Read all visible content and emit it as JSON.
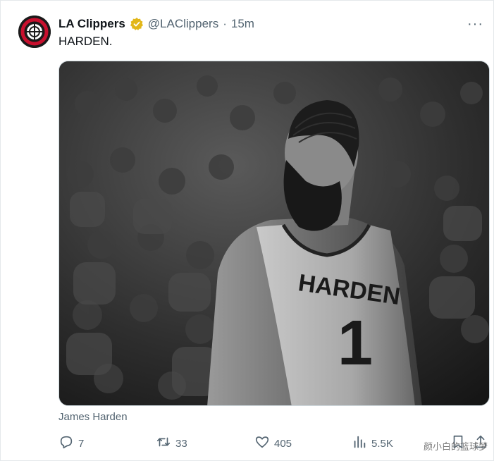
{
  "tweet": {
    "author_name": "LA Clippers",
    "handle": "@LAClippers",
    "separator": "·",
    "time": "15m",
    "text": "HARDEN.",
    "more_label": "···",
    "media_caption": "James Harden",
    "jersey_text": "HARDEN",
    "jersey_number": "1"
  },
  "actions": {
    "replies": "7",
    "reposts": "33",
    "likes": "405",
    "views": "5.5K"
  },
  "watermark": "颜小白的篮球梦",
  "icons": {
    "verified": "verified-badge-icon",
    "reply": "reply-icon",
    "repost": "repost-icon",
    "like": "heart-icon",
    "views": "views-chart-icon",
    "bookmark": "bookmark-icon",
    "share": "share-icon"
  },
  "colors": {
    "verified_gold": "#e2b719",
    "secondary_text": "#536471",
    "primary_text": "#0f1419"
  }
}
